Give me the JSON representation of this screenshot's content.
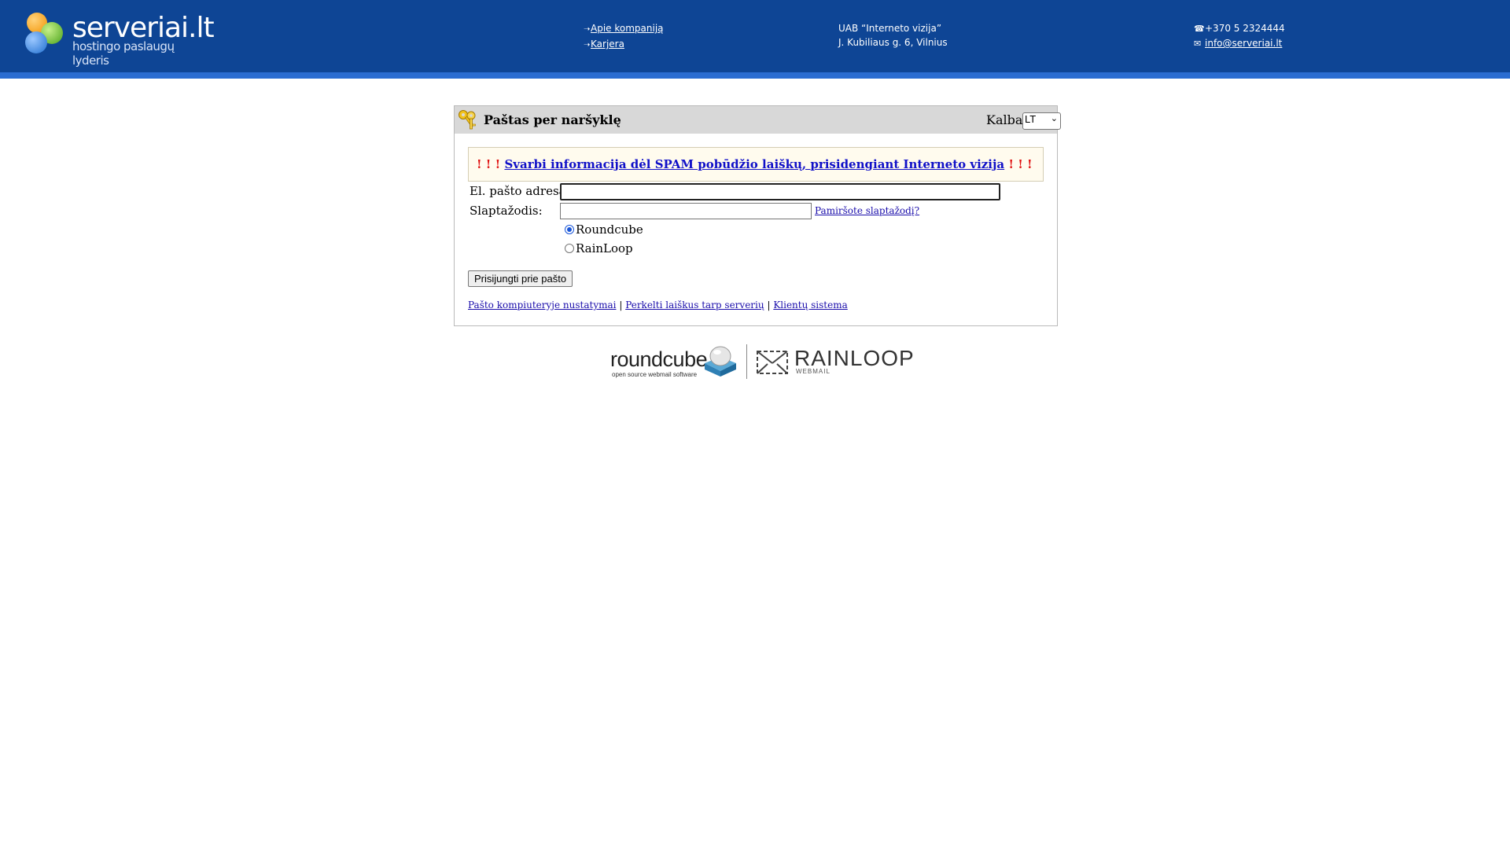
{
  "header": {
    "logo_text": "serveriai.lt",
    "logo_tagline": "hostingo paslaugų lyderis",
    "nav": [
      {
        "label": "Apie kompaniją"
      },
      {
        "label": "Karjera"
      }
    ],
    "company": {
      "name": "UAB “Interneto vizija”",
      "address": "J. Kubiliaus g. 6, Vilnius"
    },
    "contact": {
      "phone": "+370 5 2324444",
      "email": "info@serveriai.lt"
    },
    "colors": {
      "background": "#0e4595",
      "stripe": "#2b6dd1"
    }
  },
  "login_box": {
    "title": "Paštas per naršyklę",
    "language_label": "Kalba:",
    "language_value": "LT",
    "notice": {
      "prefix": "! ! !",
      "link_text": "Svarbi informacija dėl SPAM pobūdžio laiškų, prisidengiant Interneto vizija",
      "suffix": "! ! !"
    },
    "email_label": "El. pašto adresas:",
    "email_value": "",
    "password_label": "Slaptažodis:",
    "password_value": "",
    "forgot_link": "Pamiršote slaptažodį?",
    "clients": [
      {
        "label": "Roundcube",
        "selected": true
      },
      {
        "label": "RainLoop",
        "selected": false
      }
    ],
    "submit_label": "Prisijungti prie pašto",
    "footer_links": [
      {
        "label": "Pašto kompiuteryje nustatymai"
      },
      {
        "label": "Perkelti laiškus tarp serverių"
      },
      {
        "label": "Klientų sistema"
      }
    ],
    "separator": "|"
  },
  "brands": {
    "roundcube": {
      "name": "roundcube",
      "tagline": "open source webmail software"
    },
    "rainloop": {
      "name": "RAINLOOP",
      "tagline": "WEBMAIL"
    }
  }
}
